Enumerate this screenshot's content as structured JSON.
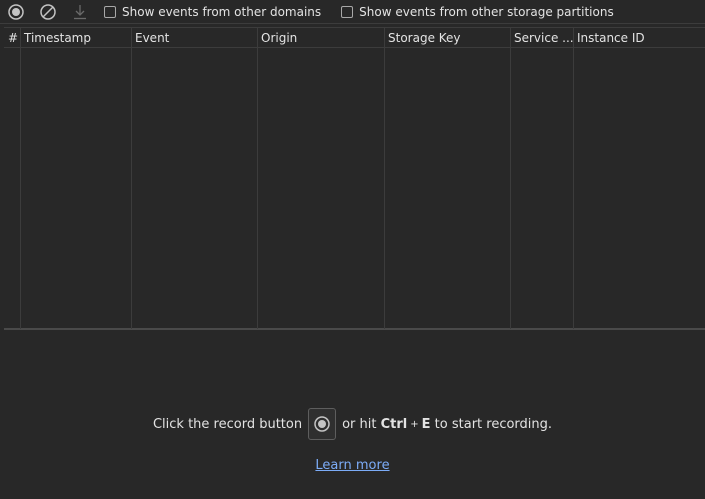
{
  "toolbar": {
    "record_icon": "record-icon",
    "clear_icon": "clear-icon",
    "download_icon": "download-icon",
    "check_other_domains": "Show events from other domains",
    "check_other_partitions": "Show events from other storage partitions"
  },
  "grid": {
    "columns": [
      "#",
      "Timestamp",
      "Event",
      "Origin",
      "Storage Key",
      "Service ...",
      "Instance ID"
    ]
  },
  "empty_state": {
    "text_before": "Click the record button",
    "text_or_hit": "or hit",
    "key_ctrl": "Ctrl",
    "key_plus": "+",
    "key_e": "E",
    "text_after": "to start recording.",
    "learn_more": "Learn more"
  },
  "colors": {
    "background": "#282828",
    "text": "#e3e3e3",
    "link": "#7cacf8",
    "divider": "#3c3c3c"
  }
}
